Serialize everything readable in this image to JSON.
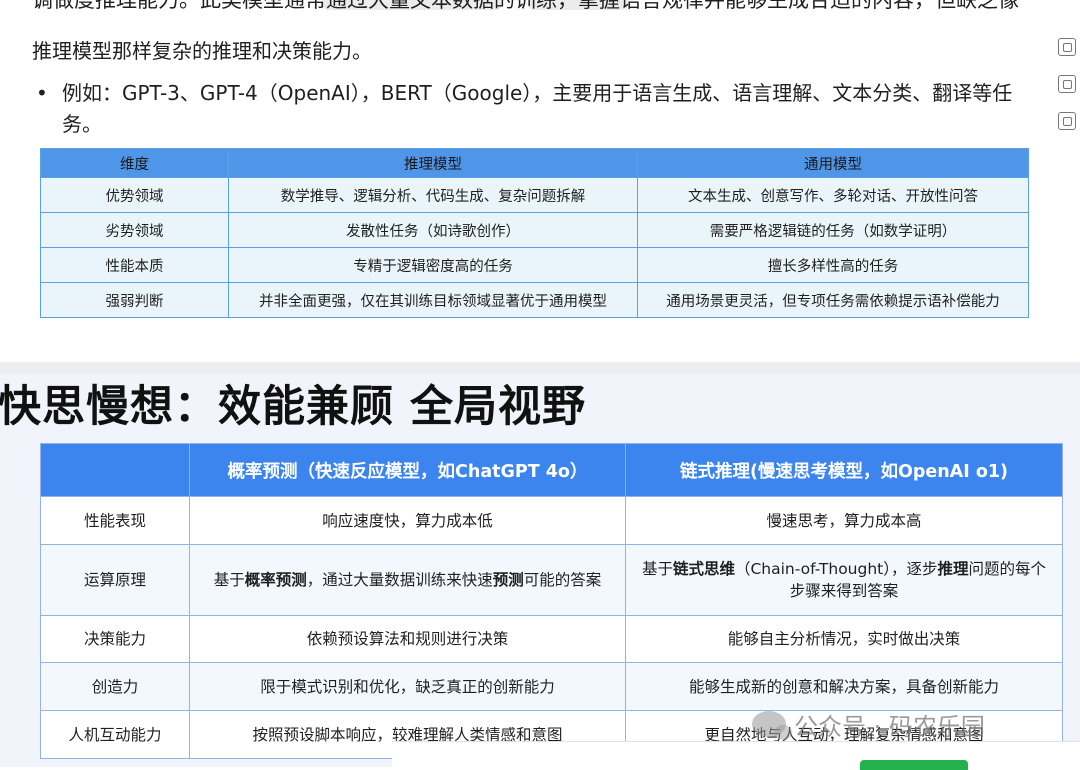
{
  "article": {
    "cut_line": "调做度推理能力。此类模型通常通过大量文本数据的训练，掌握语言规律并能够生成合适的内容，但缺乏像",
    "para1": "推理模型那样复杂的推理和决策能力。",
    "bullet": "例如：GPT-3、GPT-4（OpenAI），BERT（Google），主要用于语言生成、语言理解、文本分类、翻译等任务。",
    "table": {
      "headers": [
        "维度",
        "推理模型",
        "通用模型"
      ],
      "rows": [
        [
          "优势领域",
          "数学推导、逻辑分析、代码生成、复杂问题拆解",
          "文本生成、创意写作、多轮对话、开放性问答"
        ],
        [
          "劣势领域",
          "发散性任务（如诗歌创作）",
          "需要严格逻辑链的任务（如数学证明）"
        ],
        [
          "性能本质",
          "专精于逻辑密度高的任务",
          "擅长多样性高的任务"
        ],
        [
          "强弱判断",
          "并非全面更强，仅在其训练目标领域显著优于通用模型",
          "通用场景更灵活，但专项任务需依赖提示语补偿能力"
        ]
      ]
    }
  },
  "slide": {
    "title": "快思慢想：效能兼顾 全局视野",
    "table": {
      "headers": [
        "",
        "概率预测（快速反应模型，如ChatGPT 4o）",
        "链式推理(慢速思考模型，如OpenAI o1)"
      ],
      "rows": [
        {
          "label": "性能表现",
          "col1": "响应速度快，算力成本低",
          "col2": "慢速思考，算力成本高"
        },
        {
          "label": "运算原理",
          "col1_a": "基于",
          "col1_b": "概率预测",
          "col1_c": "，通过大量数据训练来快速",
          "col1_d": "预测",
          "col1_e": "可能的答案",
          "col2_a": "基于",
          "col2_b": "链式思维",
          "col2_c": "（Chain-of-Thought），逐步",
          "col2_d": "推理",
          "col2_e": "问题的每个步骤来得到答案"
        },
        {
          "label": "决策能力",
          "col1": "依赖预设算法和规则进行决策",
          "col2": "能够自主分析情况，实时做出决策"
        },
        {
          "label": "创造力",
          "col1": "限于模式识别和优化，缺乏真正的创新能力",
          "col2": "能够生成新的创意和解决方案，具备创新能力"
        },
        {
          "label": "人机互动能力",
          "col1": "按照预设脚本响应，较难理解人类情感和意图",
          "col2": "更自然地与人互动，理解复杂情感和意图"
        }
      ]
    }
  },
  "watermark": "公众号 · 码农乐园",
  "icons": {
    "side_tools": [
      "copy-icon",
      "copy-icon",
      "copy-icon"
    ],
    "watermark_logo": "wechat-icon"
  }
}
